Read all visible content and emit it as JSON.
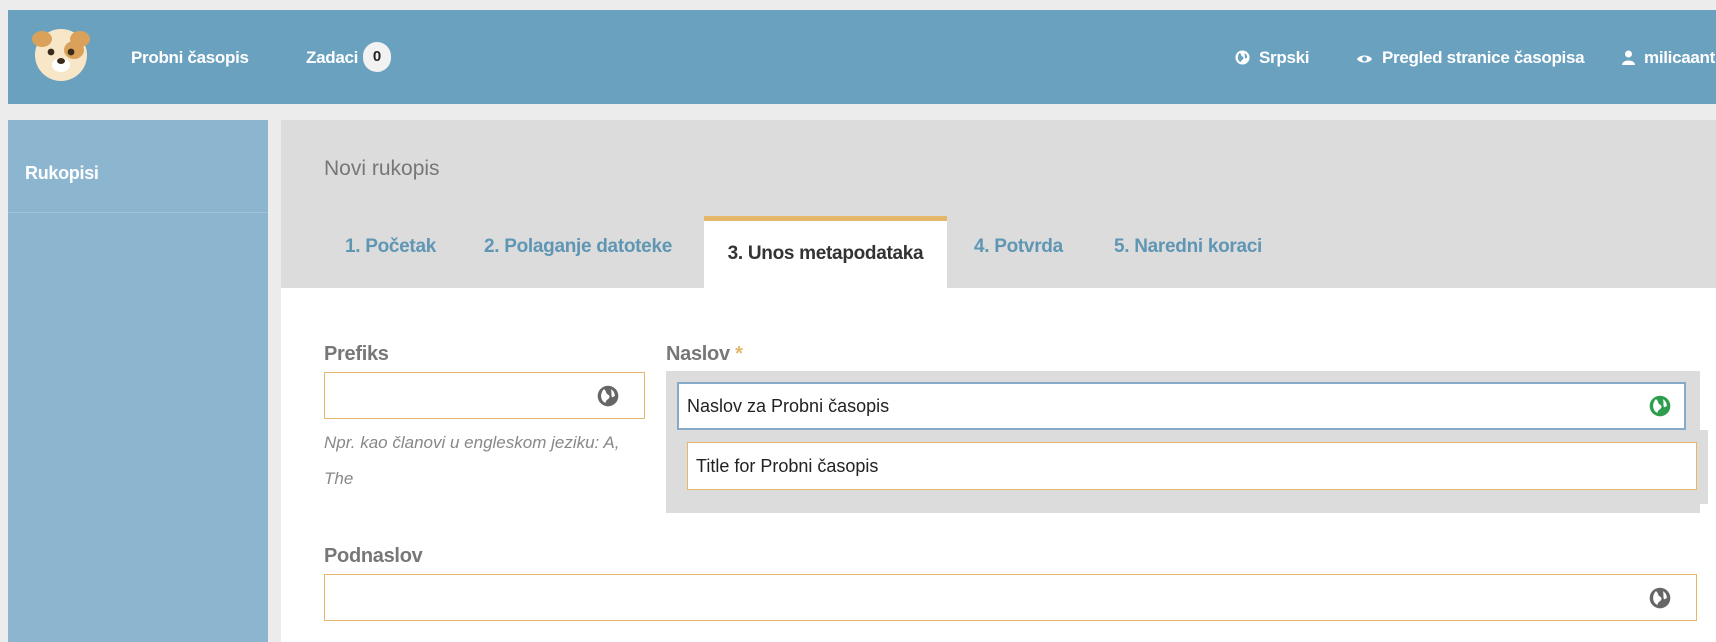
{
  "header": {
    "journal_name": "Probni časopis",
    "tasks_label": "Zadaci",
    "tasks_count": "0",
    "language_label": "Srpski",
    "view_site_label": "Pregled stranice časopisa",
    "user_label": "milicaant"
  },
  "sidebar": {
    "items": [
      {
        "label": "Rukopisi"
      }
    ]
  },
  "page": {
    "title": "Novi rukopis",
    "tabs": [
      {
        "label": "1. Početak"
      },
      {
        "label": "2. Polaganje datoteke"
      },
      {
        "label": "3. Unos metapodataka",
        "active": true
      },
      {
        "label": "4. Potvrda"
      },
      {
        "label": "5. Naredni koraci"
      }
    ]
  },
  "form": {
    "prefix_label": "Prefiks",
    "prefix_value": "",
    "prefix_hint": "Npr. kao članovi u engleskom jeziku: A, The",
    "title_label": "Naslov",
    "required_mark": "*",
    "title_value": "Naslov za Probni časopis",
    "title_en_value": "Title for Probni časopis",
    "subtitle_label": "Podnaslov",
    "subtitle_value": ""
  },
  "colors": {
    "header_bg": "#6aa1bf",
    "sidebar_bg": "#8cb6d0",
    "accent": "#e5b76a",
    "tab_link": "#5f96b4",
    "globe_active": "#2e9e4e",
    "globe_inactive": "#666666"
  },
  "icons": {
    "logo": "dog-logo-icon",
    "language": "globe-icon",
    "view": "eye-icon",
    "user": "user-icon",
    "multilingual": "globe-icon"
  }
}
